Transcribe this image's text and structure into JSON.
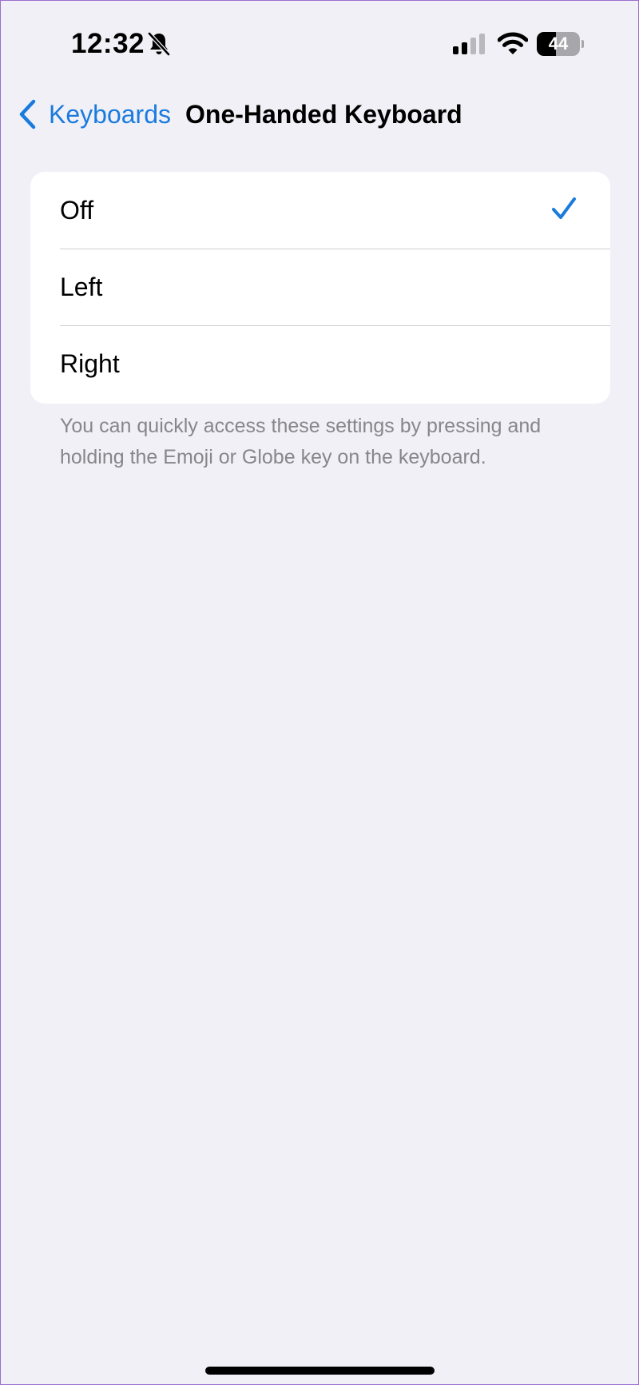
{
  "status_bar": {
    "time": "12:32",
    "battery_level": "44",
    "battery_fraction": 0.44,
    "signal_bars_active": 2,
    "signal_bars_total": 4,
    "icons": [
      "bell-slash-icon",
      "signal-icon",
      "wifi-icon",
      "battery-icon"
    ]
  },
  "nav": {
    "back_label": "Keyboards",
    "title": "One-Handed Keyboard"
  },
  "options": {
    "items": [
      {
        "label": "Off",
        "selected": true
      },
      {
        "label": "Left",
        "selected": false
      },
      {
        "label": "Right",
        "selected": false
      }
    ],
    "footer": "You can quickly access these settings by pressing and holding the Emoji or Globe key on the keyboard."
  },
  "colors": {
    "accent": "#1a7bde",
    "background": "#f1f0f6",
    "secondary_text": "#86868b"
  }
}
